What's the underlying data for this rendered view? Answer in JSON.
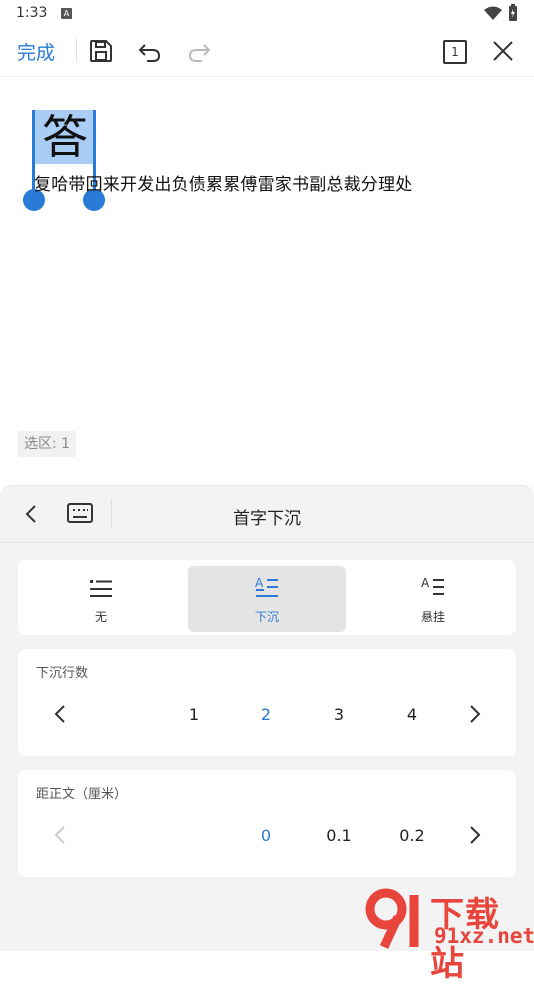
{
  "status_bar": {
    "time": "1:33",
    "notification_badge": "A"
  },
  "toolbar": {
    "done_label": "完成",
    "page_indicator": "1"
  },
  "editor": {
    "drop_cap_char": "答",
    "body_text": "复哈带回来开发出负债累累傅雷家书副总裁分理处",
    "selection_info": "选区: 1"
  },
  "panel": {
    "title": "首字下沉",
    "options": [
      {
        "label": "无",
        "selected": false
      },
      {
        "label": "下沉",
        "selected": true
      },
      {
        "label": "悬挂",
        "selected": false
      }
    ],
    "lines_section": {
      "label": "下沉行数",
      "values": [
        "1",
        "2",
        "3",
        "4"
      ],
      "selected": "2"
    },
    "distance_section": {
      "label": "距正文（厘米）",
      "values": [
        "0",
        "0.1",
        "0.2"
      ],
      "selected": "0"
    }
  },
  "watermark": {
    "line1": "下载站",
    "line2": "91xz.net"
  },
  "colors": {
    "accent": "#2a7bd8",
    "selection": "#a9cdf4",
    "watermark": "#e8453c",
    "panel_bg": "#f3f3f3"
  }
}
